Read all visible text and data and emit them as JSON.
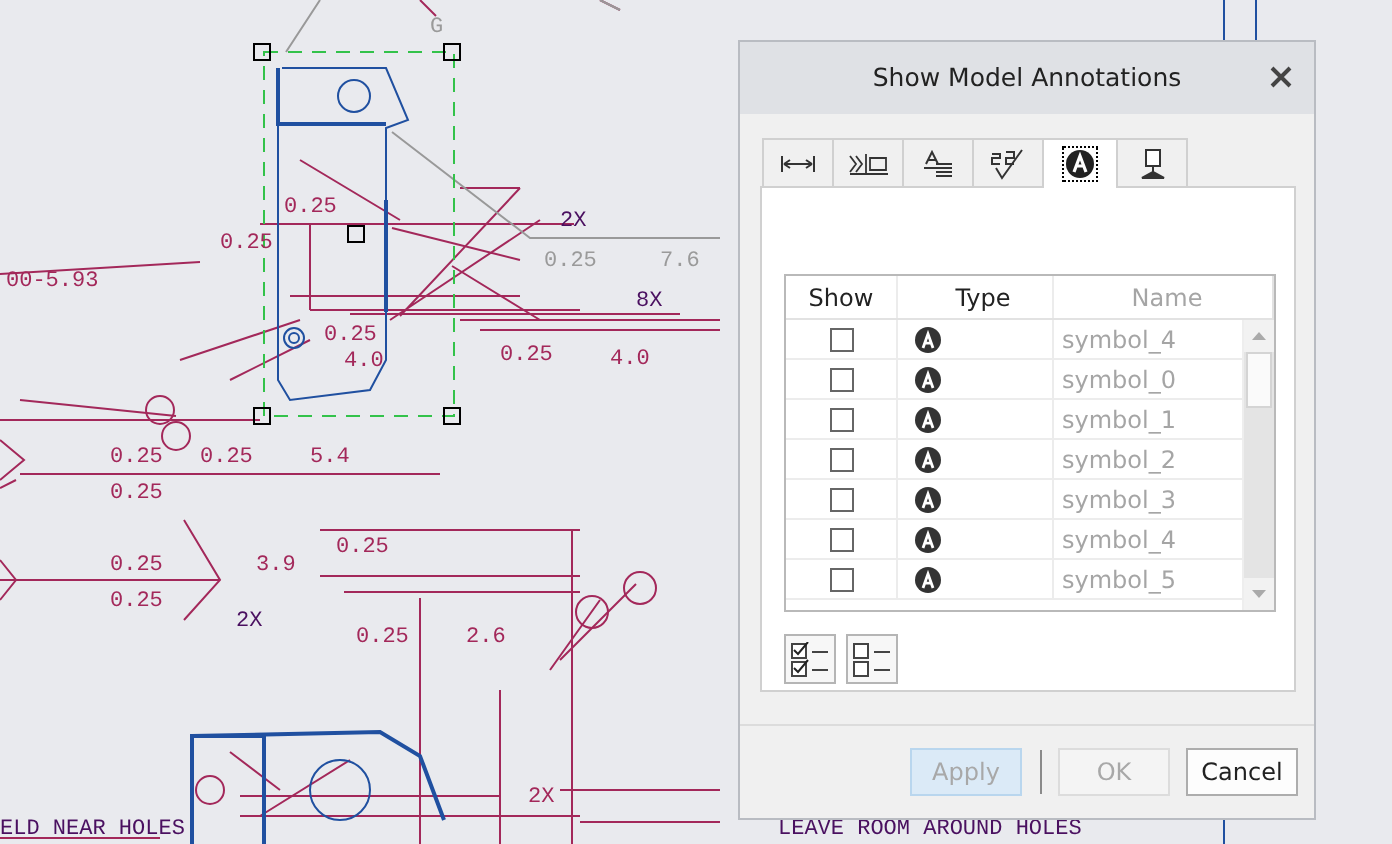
{
  "drawing": {
    "labels": [
      {
        "text": "G",
        "color": "#9a9a9a"
      },
      {
        "text": "2X",
        "color": "#4a1060"
      },
      {
        "text": "0.25",
        "color": "#9a9a9a"
      },
      {
        "text": "7.6",
        "color": "#9a9a9a"
      },
      {
        "text": "0.25",
        "color": "#a3285a"
      },
      {
        "text": "0.25",
        "color": "#a3285a"
      },
      {
        "text": "00-5.93",
        "color": "#a3285a"
      },
      {
        "text": "8X",
        "color": "#4a1060"
      },
      {
        "text": "0.25",
        "color": "#a3285a"
      },
      {
        "text": "4.0",
        "color": "#a3285a"
      },
      {
        "text": "0.25",
        "color": "#a3285a"
      },
      {
        "text": "4.0",
        "color": "#a3285a"
      },
      {
        "text": "0.25",
        "color": "#a3285a"
      },
      {
        "text": "0.25",
        "color": "#a3285a"
      },
      {
        "text": "5.4",
        "color": "#a3285a"
      },
      {
        "text": "0.25",
        "color": "#a3285a"
      },
      {
        "text": "0.25",
        "color": "#a3285a"
      },
      {
        "text": "0.25",
        "color": "#a3285a"
      },
      {
        "text": "3.9",
        "color": "#a3285a"
      },
      {
        "text": "0.25",
        "color": "#a3285a"
      },
      {
        "text": "2X",
        "color": "#4a1060"
      },
      {
        "text": "0.25",
        "color": "#a3285a"
      },
      {
        "text": "2.6",
        "color": "#a3285a"
      },
      {
        "text": "2X",
        "color": "#a3285a"
      },
      {
        "text": "ELD NEAR HOLES",
        "color": "#4a1060"
      },
      {
        "text": "LEAVE ROOM AROUND HOLES",
        "color": "#4a1060"
      }
    ]
  },
  "dialog": {
    "title": "Show Model Annotations",
    "tabs": [
      {
        "selected": false
      },
      {
        "selected": false
      },
      {
        "selected": false
      },
      {
        "selected": false
      },
      {
        "selected": true
      },
      {
        "selected": false
      }
    ],
    "table": {
      "columns": [
        "Show",
        "Type",
        "Name"
      ],
      "rows": [
        {
          "show": false,
          "name": "symbol_4"
        },
        {
          "show": false,
          "name": "symbol_0"
        },
        {
          "show": false,
          "name": "symbol_1"
        },
        {
          "show": false,
          "name": "symbol_2"
        },
        {
          "show": false,
          "name": "symbol_3"
        },
        {
          "show": false,
          "name": "symbol_4"
        },
        {
          "show": false,
          "name": "symbol_5"
        }
      ]
    },
    "buttons": [
      {
        "label": "Apply",
        "disabled": true,
        "kind": "primary"
      },
      {
        "label": "OK",
        "disabled": true,
        "kind": "normal"
      },
      {
        "label": "Cancel",
        "disabled": false,
        "kind": "normal"
      }
    ]
  }
}
